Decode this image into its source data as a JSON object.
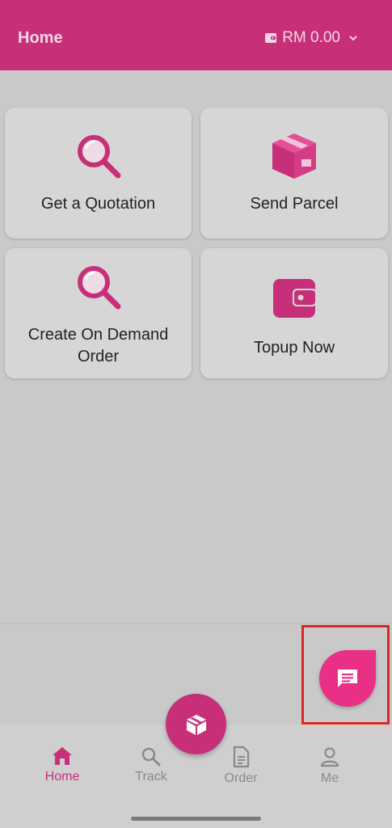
{
  "header": {
    "title": "Home",
    "wallet_balance": "RM 0.00",
    "wallet_icon": "wallet-icon",
    "chevron_icon": "chevron-down-icon"
  },
  "cards": [
    {
      "label": "Get a Quotation",
      "icon": "search-icon"
    },
    {
      "label": "Send Parcel",
      "icon": "parcel-box-icon"
    },
    {
      "label": "Create On Demand Order",
      "icon": "search-icon"
    },
    {
      "label": "Topup Now",
      "icon": "wallet-icon"
    }
  ],
  "chat_fab": {
    "icon": "chat-icon"
  },
  "center_fab": {
    "icon": "parcel-icon"
  },
  "bottom_nav": [
    {
      "label": "Home",
      "icon": "home-icon",
      "active": true
    },
    {
      "label": "Track",
      "icon": "search-icon",
      "active": false
    },
    {
      "label": "Order",
      "icon": "document-icon",
      "active": false
    },
    {
      "label": "Me",
      "icon": "person-icon",
      "active": false
    }
  ],
  "colors": {
    "brand": "#c73079",
    "fab": "#e92f86",
    "background": "#c9c9c9",
    "card": "#d6d6d6"
  }
}
